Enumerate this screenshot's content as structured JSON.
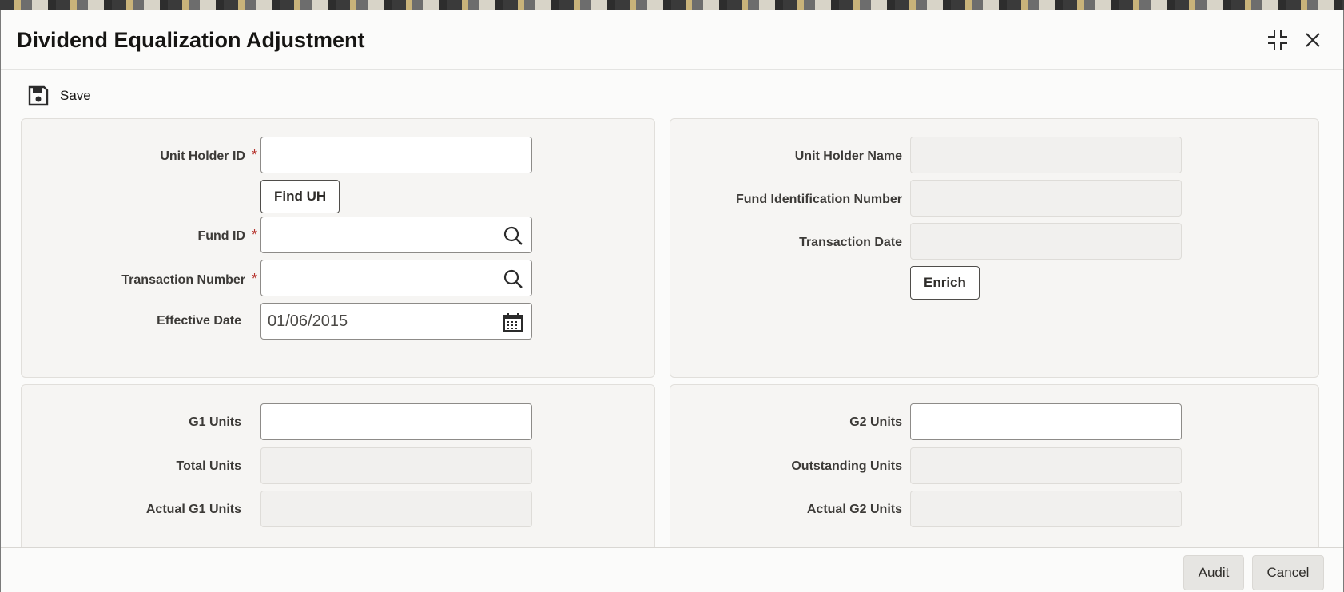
{
  "window": {
    "title": "Dividend Equalization Adjustment",
    "restore_icon": "collapse-icon",
    "close_icon": "close-icon"
  },
  "toolbar": {
    "save_label": "Save",
    "save_icon": "floppy-disk-icon"
  },
  "panel1": {
    "unit_holder_id_label": "Unit Holder ID",
    "unit_holder_id_value": "",
    "find_uh_label": "Find UH",
    "fund_id_label": "Fund ID",
    "fund_id_value": "",
    "transaction_number_label": "Transaction Number",
    "transaction_number_value": "",
    "effective_date_label": "Effective Date",
    "effective_date_value": "01/06/2015",
    "required_marker": "*"
  },
  "panel2": {
    "unit_holder_name_label": "Unit Holder Name",
    "fund_identification_number_label": "Fund Identification Number",
    "transaction_date_label": "Transaction Date",
    "enrich_label": "Enrich"
  },
  "panel3": {
    "g1_units_label": "G1 Units",
    "total_units_label": "Total Units",
    "actual_g1_units_label": "Actual G1 Units"
  },
  "panel4": {
    "g2_units_label": "G2 Units",
    "outstanding_units_label": "Outstanding Units",
    "actual_g2_units_label": "Actual G2 Units"
  },
  "footer": {
    "audit_label": "Audit",
    "cancel_label": "Cancel"
  }
}
